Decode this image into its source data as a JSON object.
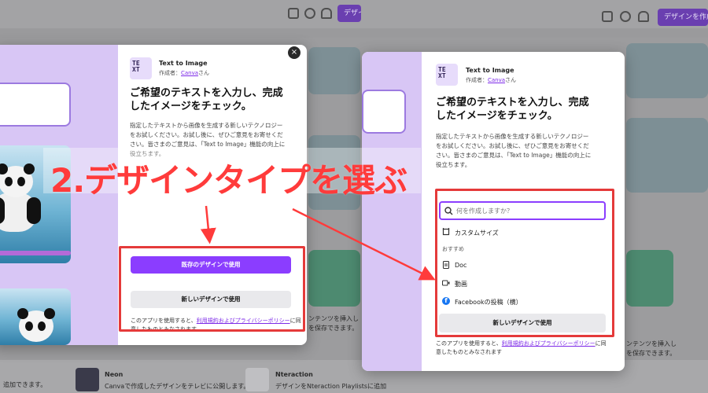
{
  "colors": {
    "accent": "#8b3dff",
    "highlight": "#e53a3a",
    "annotation": "#ff3b3b",
    "link": "#7d2ae8"
  },
  "topbar": {
    "icons": [
      "monitor-icon",
      "gear-icon",
      "bell-icon"
    ],
    "button_label_left": "デザイン",
    "button_label_right": "デザインを作成"
  },
  "annotation": {
    "label": "2.デザインタイプを選ぶ"
  },
  "app": {
    "icon_text": "TEXT",
    "title": "Text to Image",
    "author_prefix": "作成者：",
    "author_name": "Canva",
    "author_suffix": "さん",
    "heading_line1": "ご希望のテキストを入力し、完成",
    "heading_line2": "したイメージをチェック。",
    "description_left": [
      "指定したテキストから画像を生成する新しいテクノロジー",
      "をお試しください。お試し後に、ぜひご意見をお寄せくだ",
      "さい。皆さまのご意見は、「Text to Image」機能の向上に",
      "役立ちます。"
    ],
    "description_right": [
      "指定したテキストから画像を生成する新しいテクノロジー",
      "をお試しください。お試し後に、ぜひご意見をお寄せくだ",
      "さい。皆さまのご意見は、「Text to Image」機能の向上に",
      "役立ちます。"
    ]
  },
  "left_modal": {
    "use_existing_button": "既存のデザインで使用",
    "new_design_button": "新しいデザインで使用",
    "fine_print_prefix": "このアプリを使用すると、",
    "fine_print_link": "利用規約およびプライバシーポリシー",
    "fine_print_suffix": "に同",
    "fine_print_line2": "意したものとみなされます"
  },
  "right_modal": {
    "search_placeholder": "何を作成しますか？",
    "custom_size": "カスタムサイズ",
    "recommended": "おすすめ",
    "items": [
      "Doc",
      "動画",
      "Facebookの投稿（横）"
    ],
    "new_design_button": "新しいデザインで使用",
    "fine_print_prefix": "このアプリを使用すると、",
    "fine_print_link": "利用規約およびプライバシーポリシー",
    "fine_print_suffix": "に同",
    "fine_print_line2": "意したものとみなされます"
  },
  "background": {
    "left_caption": "追加できます。",
    "neon_title": "Neon",
    "neon_desc": "Canvaで作成したデザインをテレビに公開します。",
    "nteraction_title": "Nteraction",
    "nteraction_desc": "デザインをNteraction Playlistsに追加",
    "side_text_1": "ンテンツを挿入し",
    "side_text_2": "を保存できます。",
    "right_side_text_1": "ンテンツを挿入し",
    "right_side_text_2": "を保存できます。"
  }
}
